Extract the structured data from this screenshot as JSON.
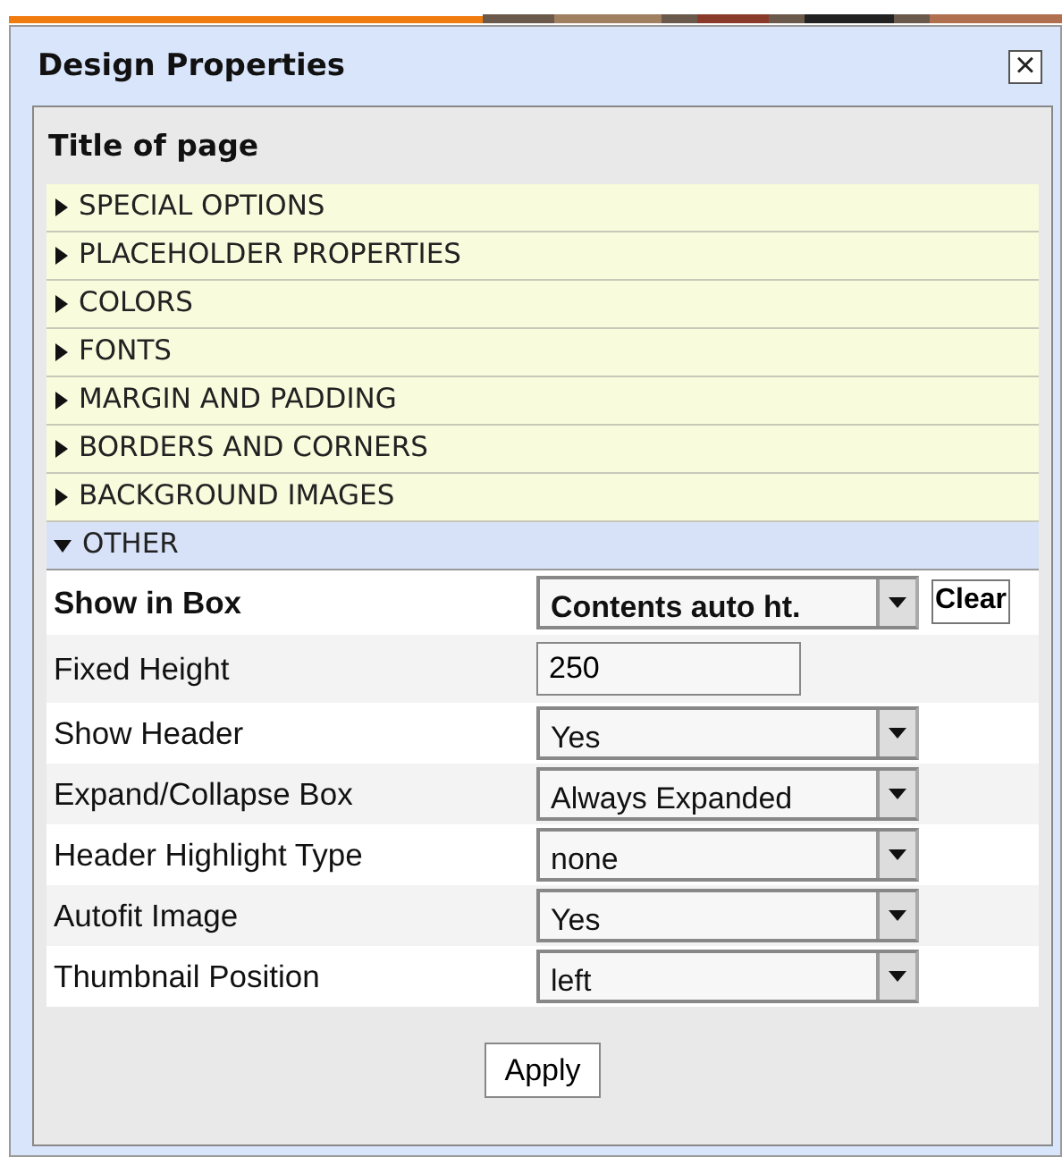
{
  "window": {
    "title": "Design Properties",
    "close": "×"
  },
  "panel_title": "Title of page",
  "sections": [
    {
      "label": "SPECIAL OPTIONS",
      "expanded": false
    },
    {
      "label": "PLACEHOLDER PROPERTIES",
      "expanded": false
    },
    {
      "label": "COLORS",
      "expanded": false
    },
    {
      "label": "FONTS",
      "expanded": false
    },
    {
      "label": "MARGIN AND PADDING",
      "expanded": false
    },
    {
      "label": "BORDERS AND CORNERS",
      "expanded": false
    },
    {
      "label": "BACKGROUND IMAGES",
      "expanded": false
    },
    {
      "label": "OTHER",
      "expanded": true
    }
  ],
  "properties": [
    {
      "label": "Show in Box",
      "kind": "select",
      "value": "Contents auto ht.",
      "bold": true,
      "button": "Clear"
    },
    {
      "label": "Fixed Height",
      "kind": "input",
      "value": "250",
      "bold": false
    },
    {
      "label": "Show Header",
      "kind": "select",
      "value": "Yes",
      "bold": false
    },
    {
      "label": "Expand/Collapse Box",
      "kind": "select",
      "value": "Always Expanded",
      "bold": false
    },
    {
      "label": "Header Highlight Type",
      "kind": "select",
      "value": "none",
      "bold": false
    },
    {
      "label": "Autofit Image",
      "kind": "select",
      "value": "Yes",
      "bold": false
    },
    {
      "label": "Thumbnail Position",
      "kind": "select",
      "value": "left",
      "bold": false
    }
  ],
  "apply_button": "Apply"
}
